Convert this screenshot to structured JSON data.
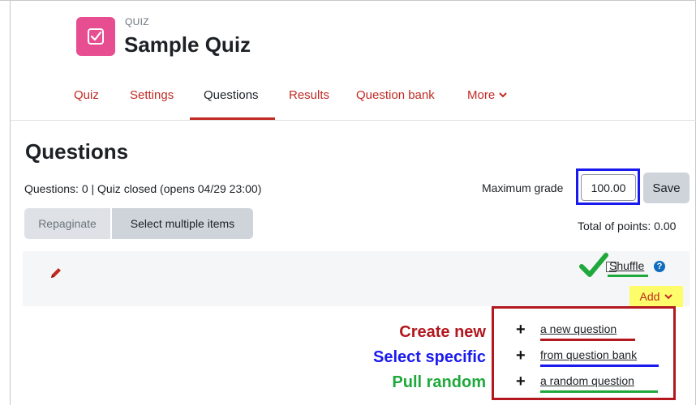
{
  "header": {
    "pretitle": "QUIZ",
    "title": "Sample Quiz",
    "icon": "checkbox-icon",
    "icon_color": "#e74e92"
  },
  "nav": {
    "tabs": [
      {
        "label": "Quiz"
      },
      {
        "label": "Settings"
      },
      {
        "label": "Questions",
        "active": true
      },
      {
        "label": "Results"
      },
      {
        "label": "Question bank"
      },
      {
        "label": "More"
      }
    ]
  },
  "main": {
    "heading": "Questions",
    "status": "Questions: 0 | Quiz closed (opens 04/29 23:00)",
    "max_grade_label": "Maximum grade",
    "max_grade_value": "100.00",
    "save_label": "Save",
    "repaginate_label": "Repaginate",
    "select_multiple_label": "Select multiple items",
    "total_points": "Total of points: 0.00"
  },
  "section": {
    "shuffle_label": "Shuffle",
    "shuffle_checked": true,
    "add_label": "Add"
  },
  "add_menu": {
    "items": [
      {
        "label": "a new question",
        "legend": "Create new",
        "color": "#b2181e"
      },
      {
        "label": "from question bank",
        "legend": "Select specific",
        "color": "#1a1aee"
      },
      {
        "label": "a random question",
        "legend": "Pull random",
        "color": "#1fa83b"
      }
    ]
  },
  "colors": {
    "accent": "#c12a23",
    "highlight_yellow": "#fdfd6b",
    "grade_box": "#1a1aee",
    "menu_box": "#b2181e",
    "check_green": "#1fa83b"
  }
}
